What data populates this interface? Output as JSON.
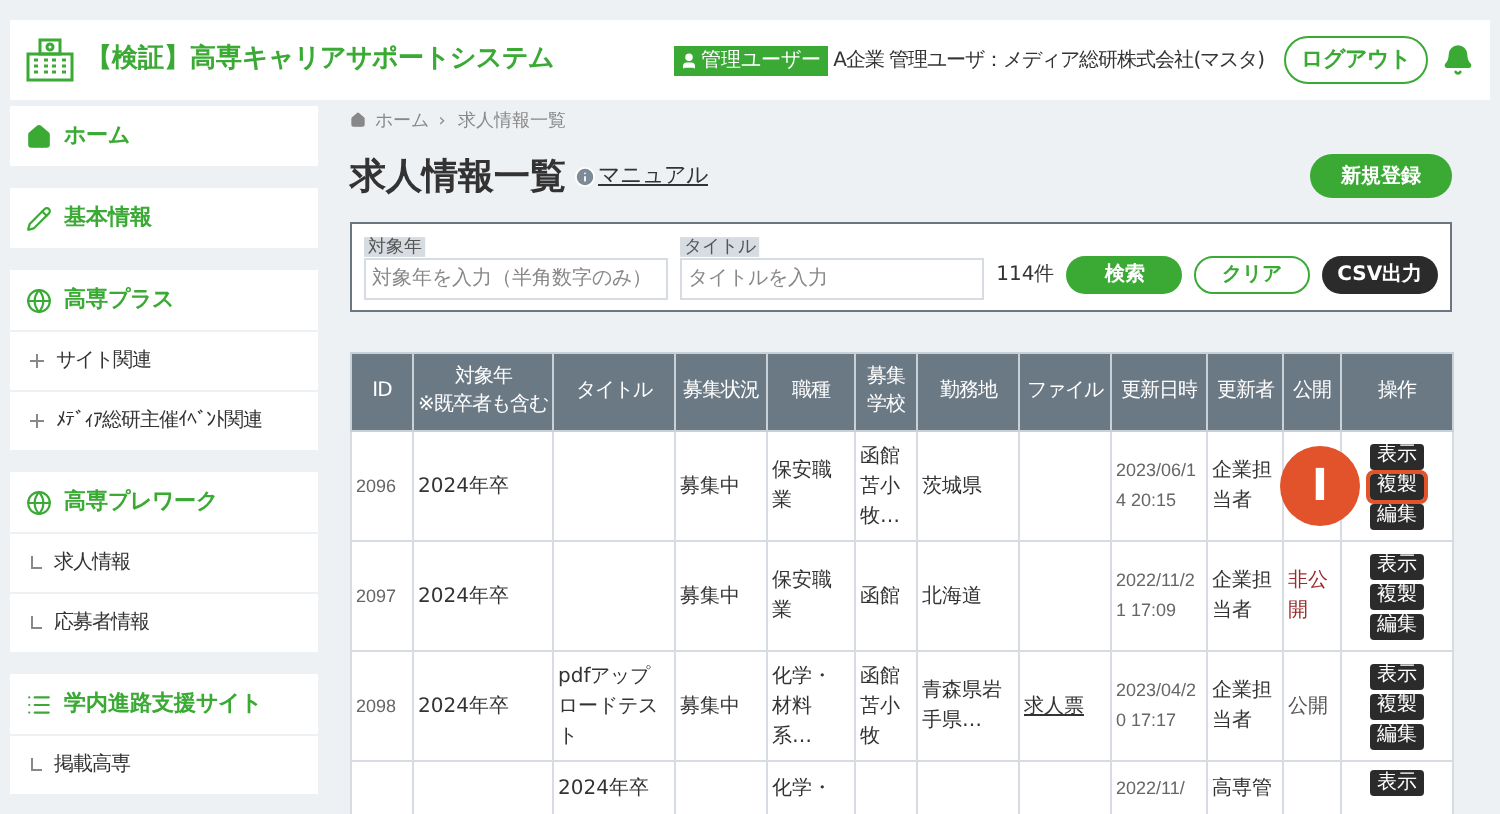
{
  "header": {
    "title": "【検証】高専キャリアサポートシステム",
    "badge": "管理ユーザー",
    "user": "A企業 管理ユーザ：メディア総研株式会社(マスタ)",
    "logout": "ログアウト"
  },
  "sidebar": [
    {
      "kind": "home",
      "label": "ホーム"
    },
    {
      "kind": "edit",
      "label": "基本情報"
    },
    {
      "kind": "globe",
      "label": "高専プラス",
      "children": [
        {
          "kind": "plus",
          "label": "サイト関連"
        },
        {
          "kind": "plus",
          "label": "ﾒﾃﾞｨｱ総研主催ｲﾍﾞﾝﾄ関連"
        }
      ]
    },
    {
      "kind": "globe",
      "label": "高専プレワーク",
      "children": [
        {
          "kind": "branch",
          "label": "求人情報"
        },
        {
          "kind": "branch",
          "label": "応募者情報"
        }
      ]
    },
    {
      "kind": "list",
      "label": "学内進路支援サイト",
      "children": [
        {
          "kind": "branch",
          "label": "掲載高専"
        }
      ]
    }
  ],
  "breadcrumb": [
    "ホーム",
    "›",
    "求人情報一覧"
  ],
  "page_title": "求人情報一覧",
  "manual_link": "マニュアル",
  "new_button": "新規登録",
  "search": {
    "fields": [
      {
        "label": "対象年",
        "placeholder": "対象年を入力（半角数字のみ）"
      },
      {
        "label": "タイトル",
        "placeholder": "タイトルを入力"
      }
    ],
    "count": "114件",
    "search_button": "検索",
    "clear_button": "クリア",
    "csv_button": "CSV出力"
  },
  "table": {
    "columns": [
      "ID",
      "対象年\n※既卒者も含む",
      "タイトル",
      "募集状況",
      "職種",
      "募集学校",
      "勤務地",
      "ファイル",
      "更新日時",
      "更新者",
      "公開",
      "操作"
    ],
    "rows": [
      {
        "id": "2096",
        "year": "2024年卒",
        "title": "",
        "status": "募集中",
        "job": "保安職業",
        "schools": "函館苫小牧…",
        "location": "茨城県",
        "file": "",
        "updated": "2023/06/14 20:15",
        "updater": "企業担当者",
        "callout": "I",
        "actions": [
          {
            "label": "表示",
            "highlighted": false
          },
          {
            "label": "複製",
            "highlighted": true
          },
          {
            "label": "編集",
            "highlighted": false
          }
        ]
      },
      {
        "id": "2097",
        "year": "2024年卒",
        "title": "",
        "status": "募集中",
        "job": "保安職業",
        "schools": "函館",
        "location": "北海道",
        "file": "",
        "updated": "2022/11/21 17:09",
        "updater": "企業担当者",
        "public": "非公開",
        "published": false,
        "actions": [
          {
            "label": "表示",
            "highlighted": false
          },
          {
            "label": "複製",
            "highlighted": false
          },
          {
            "label": "編集",
            "highlighted": false
          }
        ]
      },
      {
        "id": "2098",
        "year": "2024年卒",
        "title": "pdfアップロードテスト",
        "status": "募集中",
        "job": "化学・材料系…",
        "schools": "函館苫小牧",
        "location": "青森県岩手県…",
        "file": "求人票",
        "updated": "2023/04/20 17:17",
        "updater": "企業担当者",
        "public": "公開",
        "published": true,
        "actions": [
          {
            "label": "表示",
            "highlighted": false
          },
          {
            "label": "複製",
            "highlighted": false
          },
          {
            "label": "編集",
            "highlighted": false
          }
        ]
      },
      {
        "id": "",
        "year": "",
        "title": "2024年卒",
        "status": "",
        "job": "化学・",
        "schools": "",
        "location": "",
        "file": "",
        "updated": "2022/11/",
        "updater": "高専管",
        "actions": [
          {
            "label": "表示",
            "highlighted": false
          }
        ]
      }
    ]
  }
}
